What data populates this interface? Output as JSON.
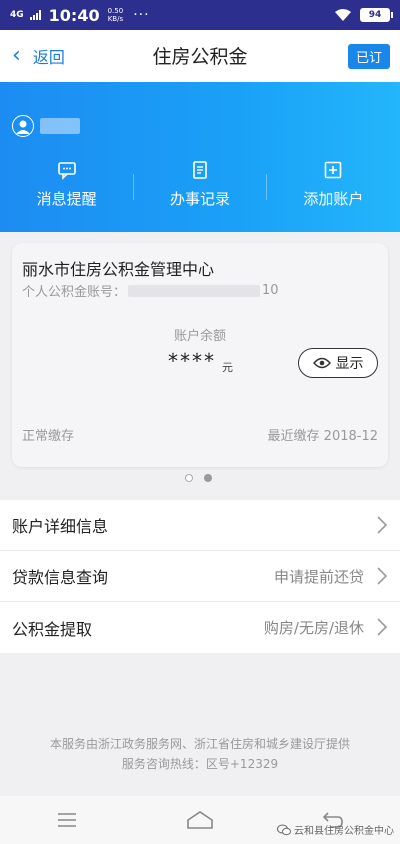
{
  "status_bar": {
    "network": "4G",
    "time": "10:40",
    "speed_value": "0.50",
    "speed_unit": "KB/s",
    "more": "···",
    "battery": "94"
  },
  "nav": {
    "back_label": "返回",
    "title": "住房公积金",
    "subscribed_label": "已订"
  },
  "quick_actions": [
    {
      "label": "消息提醒",
      "icon": "message-icon"
    },
    {
      "label": "办事记录",
      "icon": "document-icon"
    },
    {
      "label": "添加账户",
      "icon": "add-icon"
    }
  ],
  "card": {
    "center_name": "丽水市住房公积金管理中心",
    "account_label": "个人公积金账号：",
    "account_suffix": "10",
    "balance_label": "账户余额",
    "balance_value": "****",
    "balance_unit": "元",
    "show_button": "显示",
    "status": "正常缴存",
    "latest_label": "最近缴存 2018-12"
  },
  "pager": {
    "pages": 2,
    "active": 1
  },
  "list": [
    {
      "label": "账户详细信息",
      "hint": ""
    },
    {
      "label": "贷款信息查询",
      "hint": "申请提前还贷"
    },
    {
      "label": "公积金提取",
      "hint": "购房/无房/退休"
    }
  ],
  "footer": {
    "line1": "本服务由浙江政务服务网、浙江省住房和城乡建设厅提供",
    "line2": "服务咨询热线：区号+12329"
  },
  "watermark": "云和县住房公积金中心",
  "colors": {
    "accent": "#1a86e8",
    "banner_start": "#1c8cf2",
    "banner_end": "#23b6fb",
    "status_bar": "#2c2f8e"
  }
}
